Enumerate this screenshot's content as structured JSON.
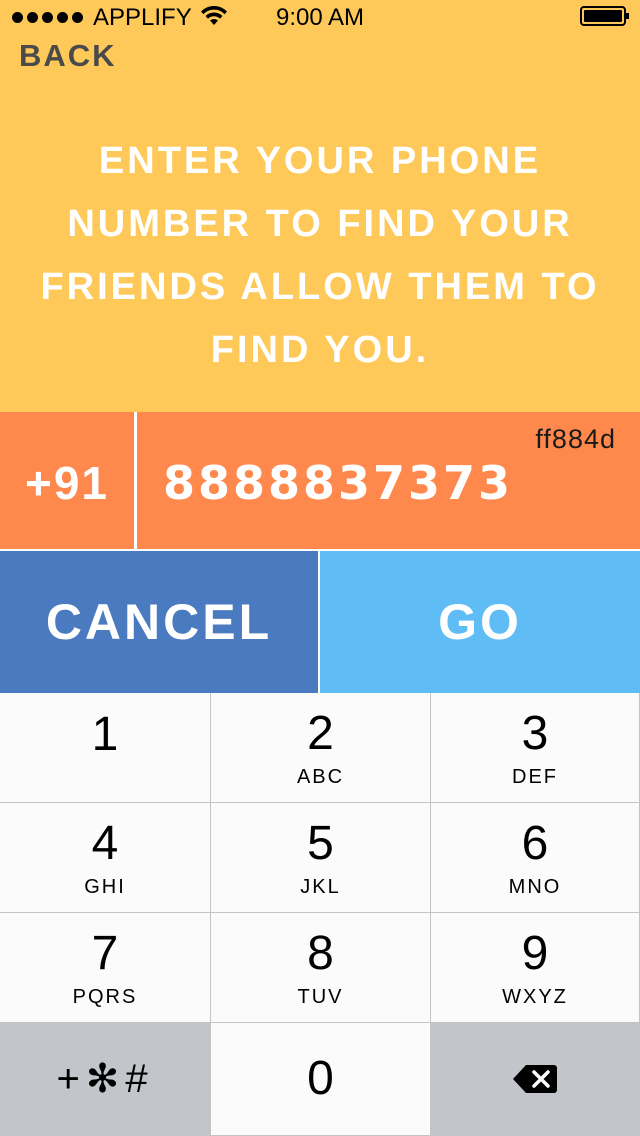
{
  "status_bar": {
    "carrier": "APPLIFY",
    "time": "9:00 AM",
    "signal_dots": 5
  },
  "header": {
    "back_label": "BACK",
    "headline": "ENTER YOUR PHONE NUMBER TO FIND YOUR FRIENDS ALLOW THEM TO FIND YOU."
  },
  "phone": {
    "country_code": "+91",
    "number": "8888837373",
    "color_label": "ff884d"
  },
  "actions": {
    "cancel_label": "CANCEL",
    "go_label": "GO"
  },
  "keypad": {
    "keys": [
      {
        "num": "1",
        "letters": ""
      },
      {
        "num": "2",
        "letters": "ABC"
      },
      {
        "num": "3",
        "letters": "DEF"
      },
      {
        "num": "4",
        "letters": "GHI"
      },
      {
        "num": "5",
        "letters": "JKL"
      },
      {
        "num": "6",
        "letters": "MNO"
      },
      {
        "num": "7",
        "letters": "PQRS"
      },
      {
        "num": "8",
        "letters": "TUV"
      },
      {
        "num": "9",
        "letters": "WXYZ"
      }
    ],
    "symbols_label": "+✻#",
    "zero": "0",
    "delete_icon": "backspace-icon"
  },
  "colors": {
    "header_bg": "#ffc95a",
    "phone_row_bg": "#ff884d",
    "cancel_bg": "#4a7abf",
    "go_bg": "#5fbcf5"
  }
}
